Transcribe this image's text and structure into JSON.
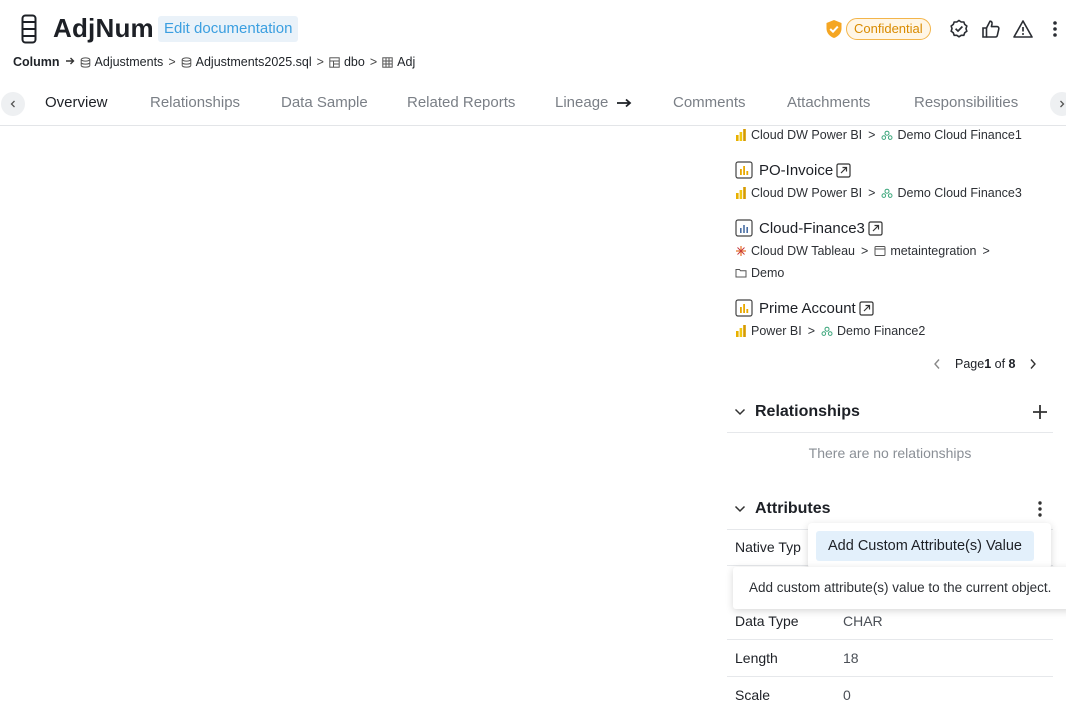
{
  "header": {
    "title": "AdjNum",
    "edit_label": "Edit documentation",
    "classification": "Confidential",
    "colors": {
      "accent": "#3b9fe0",
      "badge_border": "#f3b54a",
      "badge_text": "#d98b00",
      "shield": "#f5a623"
    }
  },
  "breadcrumb": {
    "items": [
      "Column",
      "Adjustments",
      "Adjustments2025.sql",
      "dbo",
      "Adj"
    ]
  },
  "tabs": {
    "items": [
      "Overview",
      "Relationships",
      "Data Sample",
      "Related Reports",
      "Lineage",
      "Comments",
      "Attachments",
      "Responsibilities"
    ],
    "active": "Overview"
  },
  "reports": {
    "top_path": {
      "a": "Cloud DW Power BI",
      "b": "Demo Cloud Finance1"
    },
    "items": [
      {
        "title": "PO-Invoice",
        "path_a": "Cloud DW Power BI",
        "path_b": "Demo Cloud Finance3"
      },
      {
        "title": "Cloud-Finance3",
        "path_a": "Cloud DW Tableau",
        "path_b": "metaintegration",
        "path_c": "Demo"
      },
      {
        "title": "Prime Account",
        "path_a": "Power BI",
        "path_b": "Demo Finance2"
      }
    ],
    "pager": {
      "prefix": "Page ",
      "current": "1",
      "of_label": " of ",
      "total": "8"
    }
  },
  "relationships": {
    "title": "Relationships",
    "empty": "There are no relationships"
  },
  "attributes": {
    "title": "Attributes",
    "rows": [
      {
        "key": "Native Type",
        "value": ""
      },
      {
        "key": "Data Type",
        "value": "CHAR"
      },
      {
        "key": "Length",
        "value": "18"
      },
      {
        "key": "Scale",
        "value": "0"
      }
    ],
    "native_type_visible": "Native Typ"
  },
  "menu": {
    "item_label": "Add Custom Attribute(s) Value",
    "tooltip": "Add custom attribute(s) value to the current object."
  }
}
